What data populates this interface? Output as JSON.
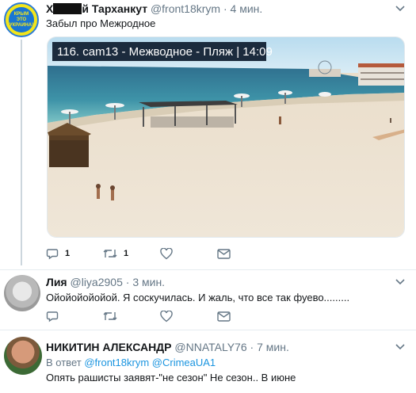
{
  "tweets": [
    {
      "name_suffix": "й Тарханкут",
      "name_prefix": "Х",
      "handle": "@front18krym",
      "dot": "·",
      "time": "4 мин.",
      "text": "Забыл про Межродное",
      "avatar_text": "КРЫМ ЭТО УКРАИНА!",
      "media_overlay": "116. cam13 - Межводное - Пляж | 14:09",
      "replies": "1",
      "retweets": "1"
    },
    {
      "name": "Лия",
      "handle": "@liya2905",
      "dot": "·",
      "time": "3 мин.",
      "text": "Ойойойойойой. Я соскучилась. И жаль, что все так фуево.........",
      "replies": "",
      "retweets": ""
    },
    {
      "name": "НИКИТИН АЛЕКСАНДР",
      "handle": "@NNATALY76",
      "dot": "·",
      "time": "7 мин.",
      "reply_prefix": "В ответ",
      "reply_user1": "@front18krym",
      "reply_user2": "@CrimeaUA1",
      "text": "Опять рашисты заявят-\"не сезон\" Не сезон.. В июне"
    }
  ]
}
